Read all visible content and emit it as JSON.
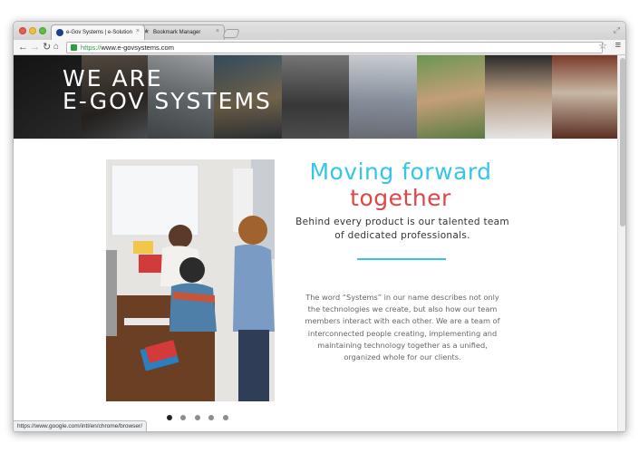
{
  "browser": {
    "tabs": [
      {
        "label": "e-Gov Systems | e-Solution",
        "close": "×"
      },
      {
        "label": "Bookmark Manager",
        "close": "×"
      }
    ],
    "address": {
      "scheme": "https://",
      "host": "www.e-govsystems.com"
    },
    "status_url": "https://www.google.com/intl/en/chrome/browser/",
    "icons": [
      "back-icon",
      "forward-icon",
      "reload-icon",
      "home-icon",
      "lock-icon",
      "star-icon",
      "menu-icon"
    ]
  },
  "hero": {
    "line1": "WE ARE",
    "line2": "E-GOV SYSTEMS"
  },
  "content": {
    "heading_line1": "Moving forward",
    "heading_line2": "together",
    "subheading": "Behind every product is our talented team of dedicated professionals.",
    "body": "The word “Systems” in our name describes not only the technologies we create, but also how our team members interact with each other. We are a team of interconnected people creating, implementing and maintaining technology together as a unified, organized whole for our clients."
  },
  "carousel": {
    "count": 5,
    "active": 1
  },
  "colors": {
    "accent_blue": "#35c5e9",
    "accent_red": "#e04646"
  }
}
